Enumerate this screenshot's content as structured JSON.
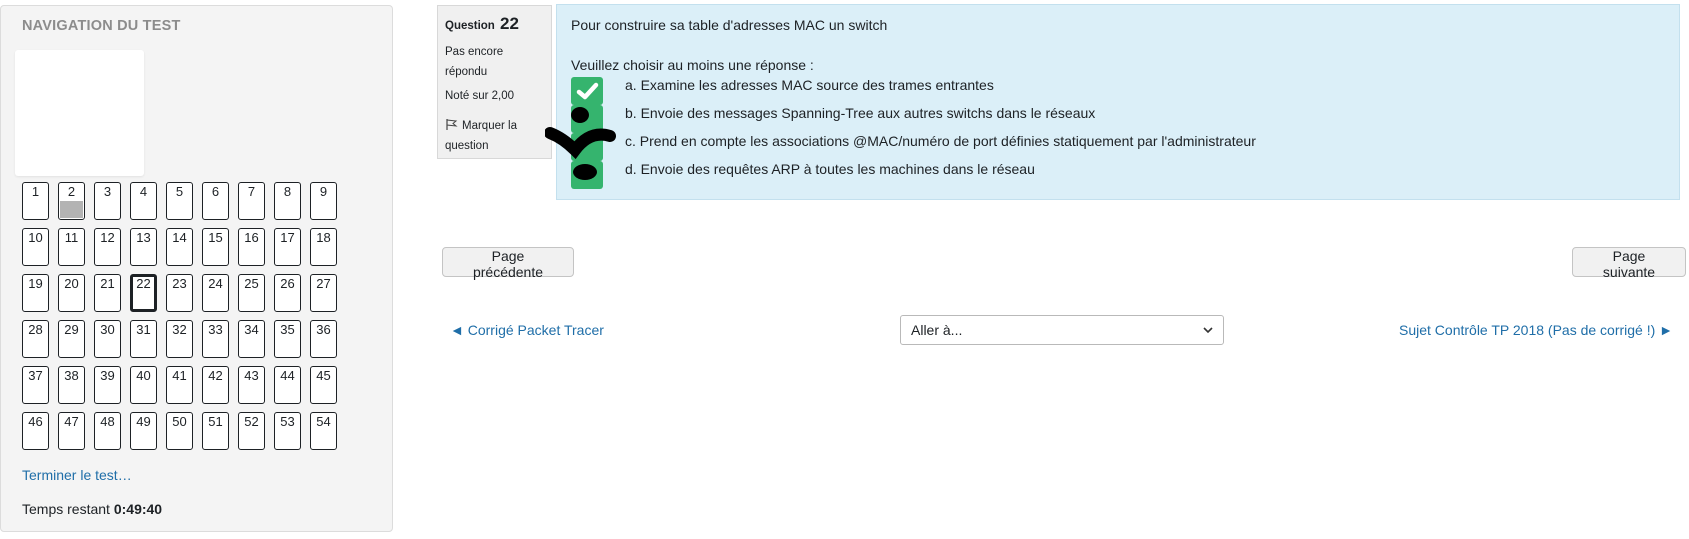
{
  "nav": {
    "title": "NAVIGATION DU TEST",
    "questions": [
      "1",
      "2",
      "3",
      "4",
      "5",
      "6",
      "7",
      "8",
      "9",
      "10",
      "11",
      "12",
      "13",
      "14",
      "15",
      "16",
      "17",
      "18",
      "19",
      "20",
      "21",
      "22",
      "23",
      "24",
      "25",
      "26",
      "27",
      "28",
      "29",
      "30",
      "31",
      "32",
      "33",
      "34",
      "35",
      "36",
      "37",
      "38",
      "39",
      "40",
      "41",
      "42",
      "43",
      "44",
      "45",
      "46",
      "47",
      "48",
      "49",
      "50",
      "51",
      "52",
      "53",
      "54"
    ],
    "answered": [
      "2"
    ],
    "current": "22",
    "finish_label": "Terminer le test…",
    "timer_label": "Temps restant",
    "timer_value": "0:49:40"
  },
  "question": {
    "label": "Question",
    "number": "22",
    "state": "Pas encore répondu",
    "grade": "Noté sur 2,00",
    "flag_label": "Marquer la question",
    "text": "Pour construire sa table d'adresses MAC un switch",
    "prompt": "Veuillez choisir au moins une réponse :",
    "answers": [
      "a. Examine les adresses MAC source des trames entrantes",
      "b. Envoie des messages Spanning-Tree aux autres switchs dans le réseaux",
      "c. Prend en compte les associations @MAC/numéro de port définies statiquement par l'administrateur",
      "d. Envoie des requêtes ARP à toutes les machines dans le réseau"
    ]
  },
  "buttons": {
    "prev_page": "Page précédente",
    "next_page": "Page suivante"
  },
  "activity_nav": {
    "prev": "◄ Corrigé Packet Tracer",
    "jump_placeholder": "Aller à...",
    "next": "Sujet Contrôle TP 2018 (Pas de corrigé !) ►"
  },
  "colors": {
    "checkbox": "#35b46e",
    "question_bg": "#dbeff8",
    "link": "#1f6ea8"
  }
}
